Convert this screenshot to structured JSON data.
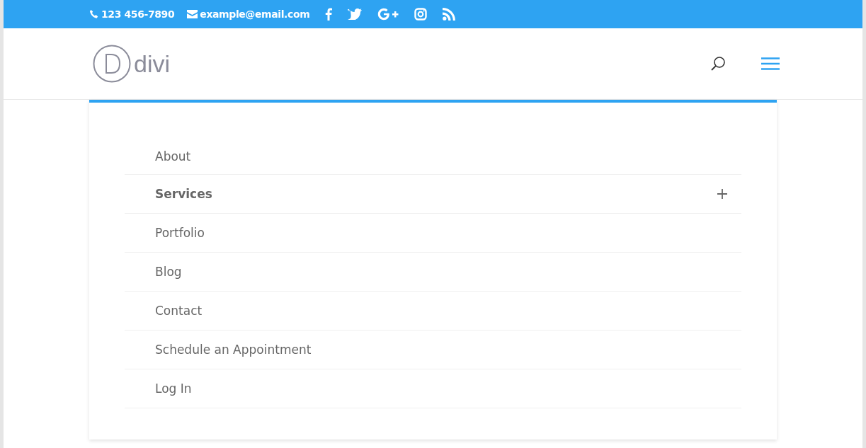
{
  "top_bar": {
    "phone": "123 456-7890",
    "email": "example@email.com"
  },
  "header": {
    "logo_text": "divi"
  },
  "menu": {
    "items": [
      {
        "label": "About",
        "has_submenu": false
      },
      {
        "label": "Services",
        "has_submenu": true
      },
      {
        "label": "Portfolio",
        "has_submenu": false
      },
      {
        "label": "Blog",
        "has_submenu": false
      },
      {
        "label": "Contact",
        "has_submenu": false
      },
      {
        "label": "Schedule an Appointment",
        "has_submenu": false
      },
      {
        "label": "Log In",
        "has_submenu": false
      }
    ]
  }
}
